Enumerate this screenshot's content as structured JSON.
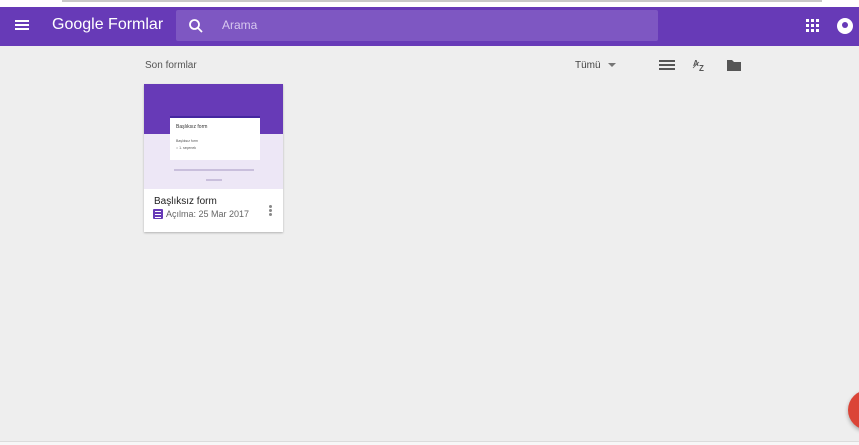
{
  "appbar": {
    "brand_google": "Google",
    "brand_product": "Formlar",
    "search_placeholder": "Arama",
    "menu_icon": "hamburger-icon",
    "apps_icon": "apps-grid-icon",
    "account_icon": "account-avatar-icon",
    "color": "#673ab7"
  },
  "toolbar": {
    "section_title": "Son formlar",
    "filter_label": "Tümü",
    "list_view_icon": "list-view-icon",
    "sort_icon": "sort-az-icon",
    "folder_icon": "folder-icon"
  },
  "forms": [
    {
      "name": "Başlıksız form",
      "opened_label": "Açılma: 25 Mar 2017",
      "thumb_title": "Başlıksız form",
      "thumb_question": "Başlıksız form",
      "thumb_option": "○ 1. seçenek"
    }
  ],
  "fab": {
    "icon": "add-icon",
    "color": "#db4437"
  }
}
